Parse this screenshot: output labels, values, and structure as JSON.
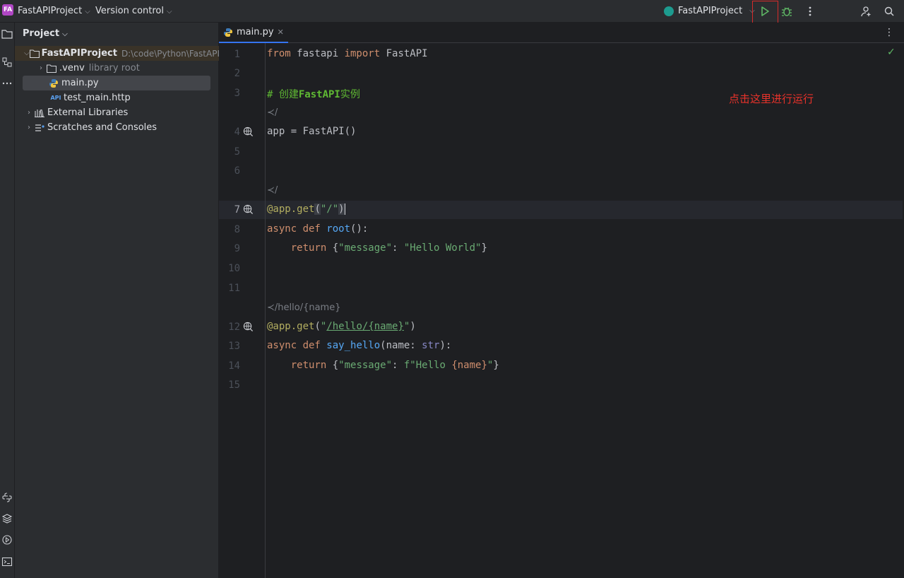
{
  "header": {
    "project_badge": "FA",
    "project_name": "FastAPIProject",
    "vcs_label": "Version control",
    "run_config": "FastAPIProject"
  },
  "project_panel": {
    "title": "Project",
    "items": [
      {
        "label": "FastAPIProject",
        "hint": "D:\\code\\Python\\FastAPIP"
      },
      {
        "label": ".venv",
        "hint": "library root"
      },
      {
        "label": "main.py"
      },
      {
        "label": "test_main.http",
        "icon_text": "API"
      },
      {
        "label": "External Libraries"
      },
      {
        "label": "Scratches and Consoles"
      }
    ]
  },
  "editor": {
    "tab_label": "main.py",
    "line_numbers": [
      "1",
      "2",
      "3",
      "4",
      "5",
      "6",
      "7",
      "8",
      "9",
      "10",
      "11",
      "12",
      "13",
      "14",
      "15"
    ],
    "hints": [
      "/",
      "/",
      "/hello/{name}"
    ],
    "code": {
      "l1": [
        "from",
        " fastapi ",
        "import",
        " FastAPI"
      ],
      "l3": [
        "# 创建",
        "FastAPI",
        "实例"
      ],
      "l4": "app = FastAPI()",
      "l7": [
        "@app.get",
        "(",
        "\"/\"",
        ")"
      ],
      "l8": [
        "async def ",
        "root",
        "():"
      ],
      "l9": [
        "    return ",
        "{",
        "\"message\"",
        ": ",
        "\"Hello World\"",
        "}"
      ],
      "l12": [
        "@app.get",
        "(",
        "\"",
        "/hello/{name}",
        "\"",
        ")"
      ],
      "l13": [
        "async def ",
        "say_hello",
        "(name: ",
        "str",
        "):"
      ],
      "l14": [
        "    return ",
        "{",
        "\"message\"",
        ": ",
        "f\"Hello ",
        "{name}",
        "\"",
        "}"
      ]
    }
  },
  "annotation": "点击这里进行运行",
  "colors": {
    "accent": "#3574f0",
    "run_green": "#5fb865",
    "annotation_red": "#e8322a"
  }
}
